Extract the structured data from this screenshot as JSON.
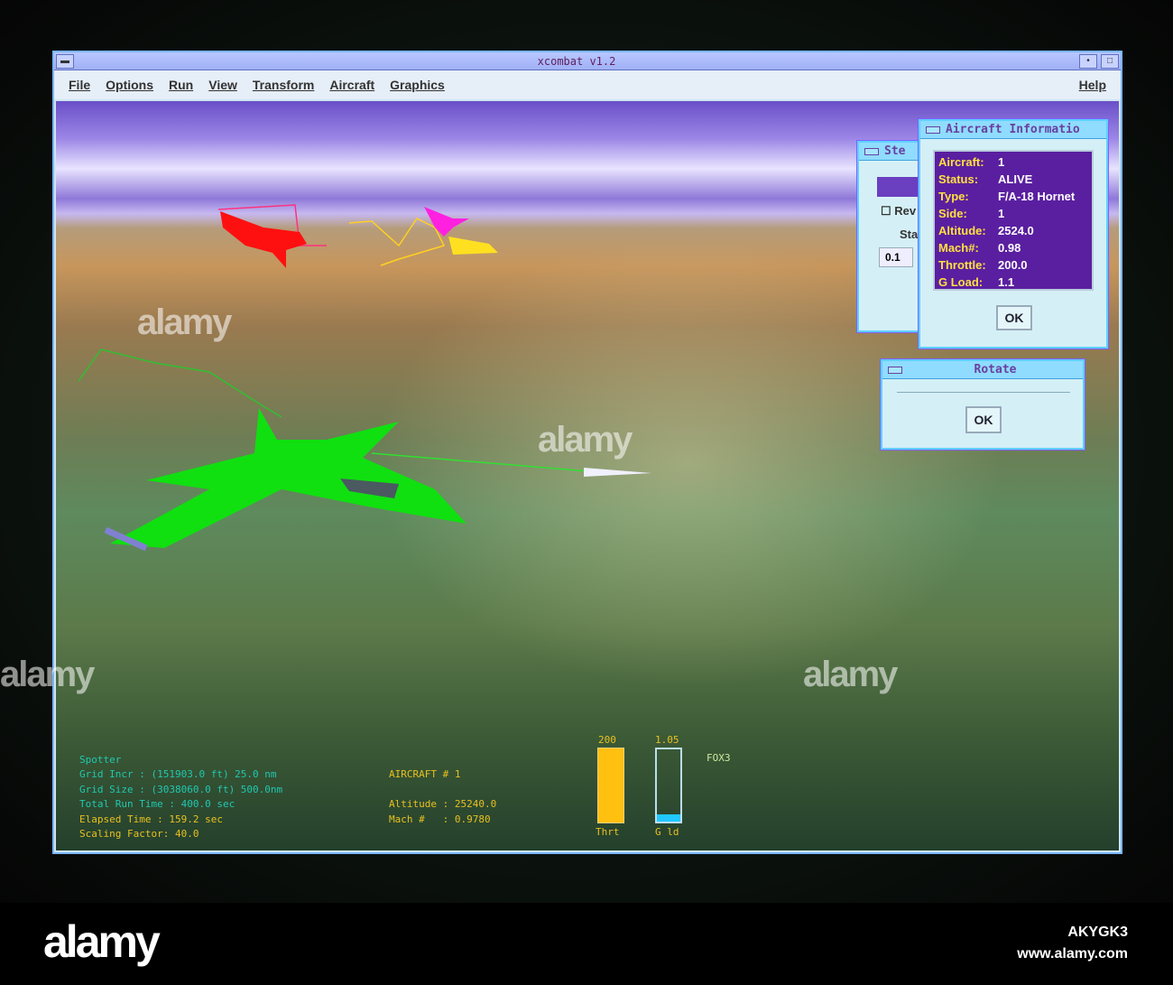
{
  "window": {
    "title": "xcombat v1.2"
  },
  "menu": [
    "File",
    "Options",
    "Run",
    "View",
    "Transform",
    "Aircraft",
    "Graphics"
  ],
  "help": "Help",
  "steps_dialog": {
    "title": "Ste",
    "checkbox": "Rev",
    "label": "Sta",
    "value": "0.1"
  },
  "info_dialog": {
    "title": "Aircraft Informatio",
    "rows": [
      {
        "k": "Aircraft:",
        "v": "1"
      },
      {
        "k": "Status:",
        "v": "ALIVE"
      },
      {
        "k": "Type:",
        "v": "F/A-18 Hornet"
      },
      {
        "k": "Side:",
        "v": "1"
      },
      {
        "k": "Altitude:",
        "v": "2524.0"
      },
      {
        "k": "Mach#:",
        "v": "0.98"
      },
      {
        "k": "Throttle:",
        "v": "200.0"
      },
      {
        "k": "G Load:",
        "v": "1.1"
      }
    ],
    "ok": "OK"
  },
  "rotate_dialog": {
    "title": "Rotate",
    "ok": "OK"
  },
  "hud": {
    "spotter": "Spotter",
    "grid_incr": "Grid Incr : (151903.0 ft) 25.0 nm",
    "grid_size": "Grid Size : (3038060.0 ft) 500.0nm",
    "total_run": "Total Run Time : 400.0 sec",
    "elapsed": "Elapsed Time : 159.2 sec",
    "scaling": "Scaling Factor: 40.0",
    "aircraft": "AIRCRAFT # 1",
    "altitude": "Altitude : 25240.0",
    "mach": "Mach #   : 0.9780",
    "throttle_value": "200",
    "throttle_label": "Thrt",
    "throttle_fraction": 1.0,
    "gload_value": "1.05",
    "gload_label": "G ld",
    "gload_fraction": 0.1,
    "weapon": "FOX3"
  },
  "colors": {
    "player": "#10e010",
    "enemy_red": "#ff1010",
    "enemy_magenta": "#ff20e0",
    "enemy_yellow": "#ffe020",
    "dialog_panel": "#5a1fa0"
  },
  "watermark": {
    "logo": "alamy",
    "id": "AKYGK3",
    "url": "www.alamy.com"
  }
}
